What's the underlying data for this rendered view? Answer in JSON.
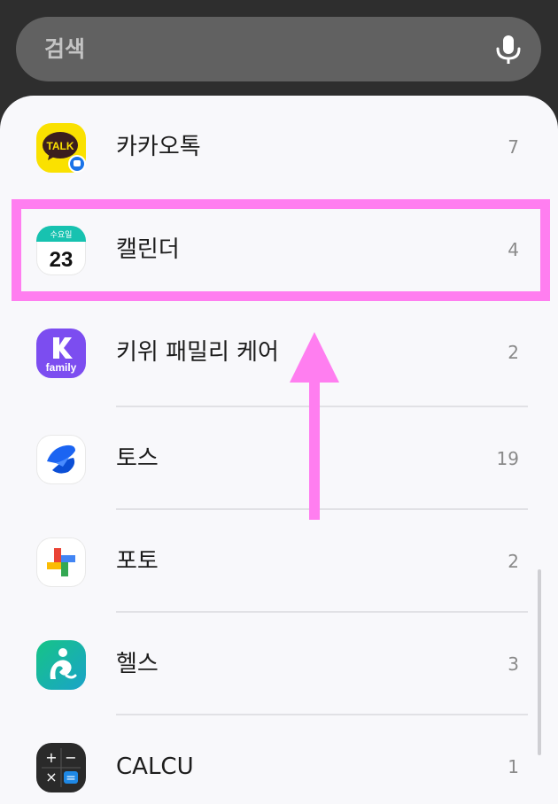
{
  "search": {
    "placeholder": "검색"
  },
  "apps": [
    {
      "name": "카카오톡",
      "count": "7",
      "icon": "kakaotalk-icon",
      "icon_text": "TALK",
      "color": "#fae100"
    },
    {
      "name": "캘린더",
      "count": "4",
      "icon": "calendar-icon",
      "icon_top": "수요일",
      "icon_date": "23",
      "color": "#17c2b0"
    },
    {
      "name": "키위 패밀리 케어",
      "count": "2",
      "icon": "kiwi-family-icon",
      "icon_text": "family",
      "color": "#7c4df0"
    },
    {
      "name": "토스",
      "count": "19",
      "icon": "toss-icon",
      "color": "#1b64f2"
    },
    {
      "name": "포토",
      "count": "2",
      "icon": "google-photos-icon"
    },
    {
      "name": "헬스",
      "count": "3",
      "icon": "health-icon",
      "color": "#1fb77d"
    },
    {
      "name": "CALCU",
      "count": "1",
      "icon": "calculator-icon",
      "icon_ops": [
        "+",
        "−",
        "×",
        "="
      ],
      "color": "#2a2a2a"
    }
  ],
  "annotation": {
    "highlight_color": "#ff7ef0",
    "arrow": "arrow-up-icon"
  }
}
